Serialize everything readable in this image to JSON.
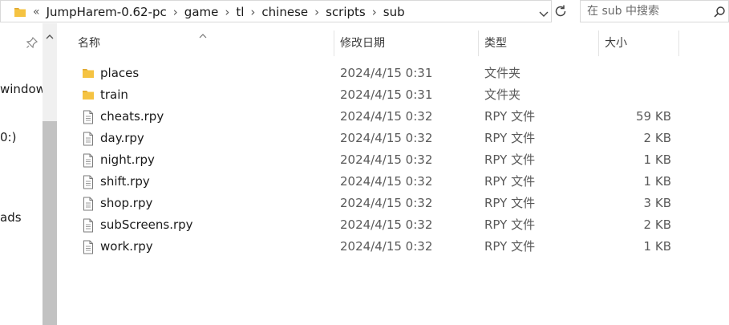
{
  "address": {
    "lead": "«",
    "crumbs": [
      "JumpHarem-0.62-pc",
      "game",
      "tl",
      "chinese",
      "scripts",
      "sub"
    ]
  },
  "search": {
    "placeholder": "在 sub 中搜索"
  },
  "nav": {
    "items": [
      "window",
      "0:)",
      "ads"
    ]
  },
  "columns": {
    "name": "名称",
    "date": "修改日期",
    "type": "类型",
    "size": "大小"
  },
  "files": [
    {
      "name": "places",
      "date": "2024/4/15 0:31",
      "type": "文件夹",
      "size": "",
      "icon": "folder-icon"
    },
    {
      "name": "train",
      "date": "2024/4/15 0:31",
      "type": "文件夹",
      "size": "",
      "icon": "folder-icon"
    },
    {
      "name": "cheats.rpy",
      "date": "2024/4/15 0:32",
      "type": "RPY 文件",
      "size": "59 KB",
      "icon": "file-icon"
    },
    {
      "name": "day.rpy",
      "date": "2024/4/15 0:32",
      "type": "RPY 文件",
      "size": "2 KB",
      "icon": "file-icon"
    },
    {
      "name": "night.rpy",
      "date": "2024/4/15 0:32",
      "type": "RPY 文件",
      "size": "1 KB",
      "icon": "file-icon"
    },
    {
      "name": "shift.rpy",
      "date": "2024/4/15 0:32",
      "type": "RPY 文件",
      "size": "1 KB",
      "icon": "file-icon"
    },
    {
      "name": "shop.rpy",
      "date": "2024/4/15 0:32",
      "type": "RPY 文件",
      "size": "3 KB",
      "icon": "file-icon"
    },
    {
      "name": "subScreens.rpy",
      "date": "2024/4/15 0:32",
      "type": "RPY 文件",
      "size": "2 KB",
      "icon": "file-icon"
    },
    {
      "name": "work.rpy",
      "date": "2024/4/15 0:32",
      "type": "RPY 文件",
      "size": "1 KB",
      "icon": "file-icon"
    }
  ],
  "colors": {
    "folder": "#f5c342",
    "folder_tab": "#e0a82e",
    "scroll_thumb": "#c2c2c2"
  }
}
